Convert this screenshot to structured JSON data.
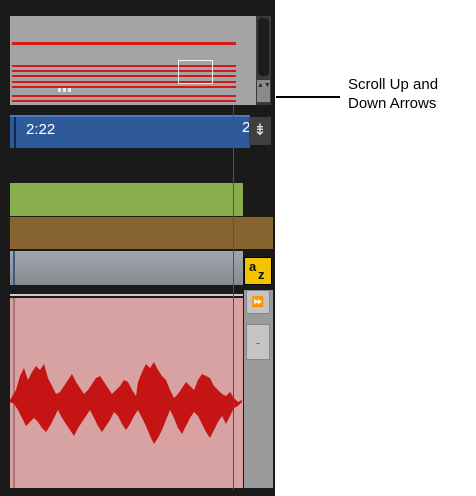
{
  "timeline": {
    "counter_label": "2:22",
    "counter_label_overflow": "2"
  },
  "buttons": {
    "edit_window_icon": "⇟",
    "az_a": "a",
    "az_z": "z",
    "forward_icon": "⏩",
    "minus_icon": "-"
  },
  "scrollbar": {
    "arrows_label": "▲▼"
  },
  "annotation": {
    "text": "Scroll Up and Down Arrows"
  },
  "colors": {
    "clip_red": "#d21a1a",
    "time_blue": "#2f5a9a",
    "track_green": "#8aae4e",
    "track_brown": "#866430",
    "az_yellow": "#f2c400",
    "audio_bg": "#d8a2a2"
  }
}
